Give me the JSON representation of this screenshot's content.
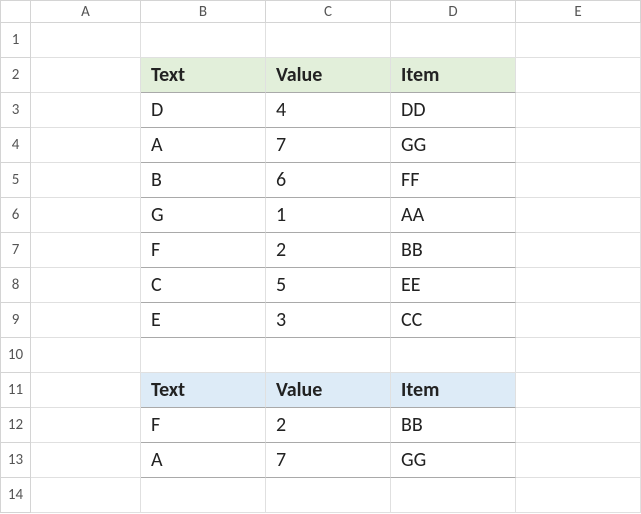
{
  "columns": [
    "A",
    "B",
    "C",
    "D",
    "E"
  ],
  "rows": [
    "1",
    "2",
    "3",
    "4",
    "5",
    "6",
    "7",
    "8",
    "9",
    "10",
    "11",
    "12",
    "13",
    "14"
  ],
  "table1": {
    "headers": {
      "text": "Text",
      "value": "Value",
      "item": "Item"
    },
    "rows": [
      {
        "text": "D",
        "value": "4",
        "item": "DD"
      },
      {
        "text": "A",
        "value": "7",
        "item": "GG"
      },
      {
        "text": "B",
        "value": "6",
        "item": "FF"
      },
      {
        "text": "G",
        "value": "1",
        "item": "AA"
      },
      {
        "text": "F",
        "value": "2",
        "item": "BB"
      },
      {
        "text": "C",
        "value": "5",
        "item": "EE"
      },
      {
        "text": "E",
        "value": "3",
        "item": "CC"
      }
    ]
  },
  "table2": {
    "headers": {
      "text": "Text",
      "value": "Value",
      "item": "Item"
    },
    "rows": [
      {
        "text": "F",
        "value": "2",
        "item": "BB"
      },
      {
        "text": "A",
        "value": "7",
        "item": "GG"
      }
    ]
  }
}
